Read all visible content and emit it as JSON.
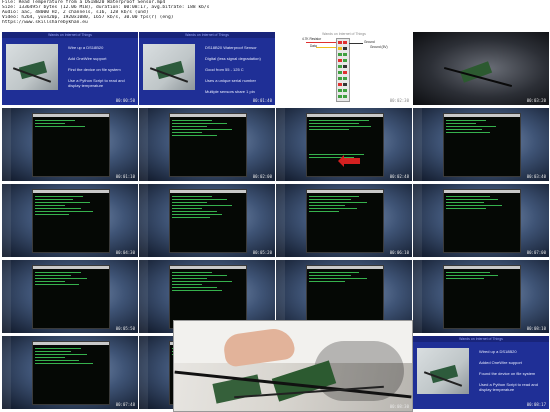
{
  "header": {
    "line1": "File: Read Temperature from a DS18B20 Waterproof Sensor.mp4",
    "line2": "Size: 13364957 bytes (12.06 MiB), duration: 00:08:17, avg.bitrate: 188 kb/s",
    "line3": "Audio: aac, 48000 Hz, 2 channels, s16, 128 kb/s (und)",
    "line4": "Video: h264, yuv420p, 1920x1080, 1657 kb/s, 30.00 fps(r) (eng)",
    "line5": "https://www.skillsharebykhan.eu"
  },
  "slide": {
    "header": "Wands on Internet of Things",
    "bullets1": [
      "Wire up a DS18B20",
      "Add OneWire support",
      "Find the device on file system",
      "Use a Python Script to read and display temperature"
    ],
    "bullets2": [
      "DS18B20 Waterproof Sensor",
      "Digital (less signal degradation)",
      "Good from 55 - 125 C",
      "Uses a unique serial number",
      "Multiple sensors share 1 pin"
    ],
    "bullets_last": [
      "Wired up a DS18B20",
      "Added OneWire support",
      "Found the device on file system",
      "Used a Python Script to read and display temperature"
    ]
  },
  "wiring": {
    "header": "Wands on Internet of Things",
    "labels": [
      "4.7K Resistor",
      "Data",
      "Ground",
      "Ground (5V)"
    ]
  },
  "timestamps": [
    "00:00:50",
    "00:01:40",
    "00:02:30",
    "00:03:20",
    "00:01:10",
    "00:02:00",
    "00:02:48",
    "00:03:40",
    "00:04:30",
    "00:05:20",
    "00:06:10",
    "00:07:00",
    "00:05:50",
    "00:06:40",
    "00:07:30",
    "00:08:10",
    "00:07:48",
    "00:08:17",
    "00:08:30",
    "00:08:17"
  ]
}
